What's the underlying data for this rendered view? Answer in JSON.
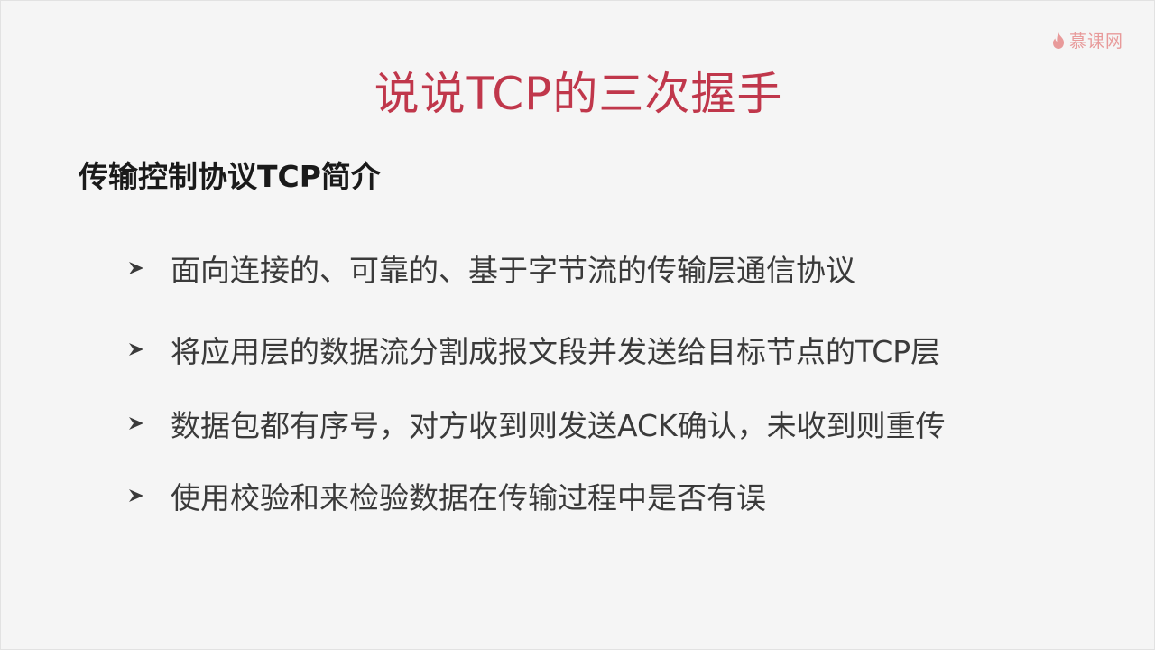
{
  "logo": {
    "text": "慕课网",
    "icon": "flame-icon",
    "color": "#e89a9a"
  },
  "slide": {
    "title": "说说TCP的三次握手",
    "subtitle": "传输控制协议TCP简介",
    "bullets": [
      "面向连接的、可靠的、基于字节流的传输层通信协议",
      "将应用层的数据流分割成报文段并发送给目标节点的TCP层",
      "数据包都有序号，对方收到则发送ACK确认，未收到则重传",
      "使用校验和来检验数据在传输过程中是否有误"
    ]
  },
  "colors": {
    "title": "#c0374b",
    "subtitle": "#1a1a1a",
    "body": "#3a3a3a"
  }
}
